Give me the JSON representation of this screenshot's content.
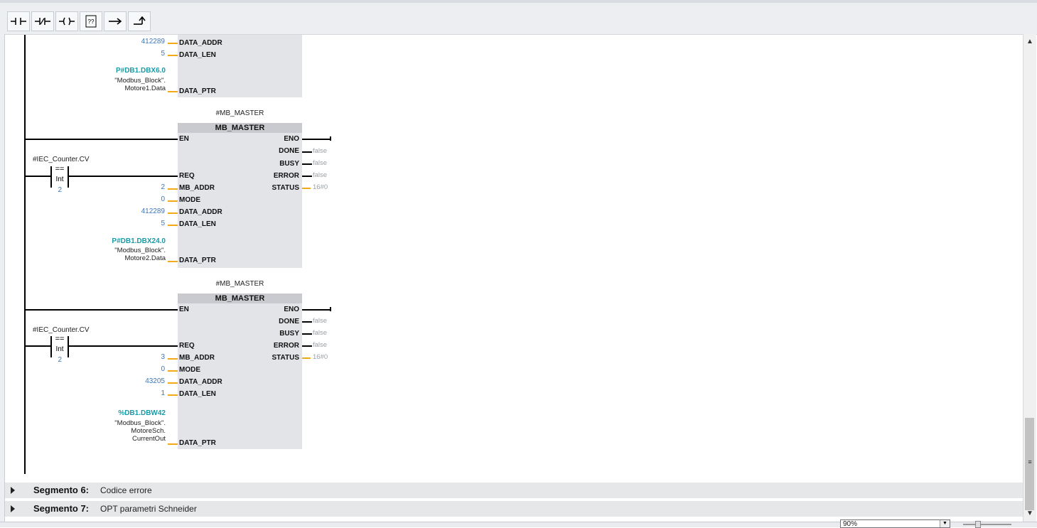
{
  "toolbar": {
    "buttons": [
      {
        "name": "normally-open-contact",
        "glyph": "no"
      },
      {
        "name": "normally-closed-contact",
        "glyph": "nc"
      },
      {
        "name": "output-coil",
        "glyph": "coil"
      },
      {
        "name": "empty-box",
        "glyph": "box",
        "label": "??"
      },
      {
        "name": "open-branch",
        "glyph": "branch"
      },
      {
        "name": "close-branch",
        "glyph": "close"
      }
    ]
  },
  "network_partial": {
    "data_addr_value": "412289",
    "data_len_value": "5",
    "ptr_address": "P#DB1.DBX6.0",
    "ptr_line1": "\"Modbus_Block\".",
    "ptr_line2": "Motore1.Data",
    "pins": {
      "data_addr": "DATA_ADDR",
      "data_len": "DATA_LEN",
      "data_ptr": "DATA_PTR"
    }
  },
  "blocks": [
    {
      "instance": "#MB_MASTER",
      "type": "MB_MASTER",
      "compare_operand": "#IEC_Counter.CV",
      "compare_op": "==",
      "compare_type": "Int",
      "compare_value": "2",
      "inputs": {
        "en": "EN",
        "req": "REQ",
        "mb_addr": "MB_ADDR",
        "mode": "MODE",
        "data_addr": "DATA_ADDR",
        "data_len": "DATA_LEN",
        "data_ptr": "DATA_PTR"
      },
      "outputs": {
        "eno": "ENO",
        "done": "DONE",
        "busy": "BUSY",
        "error": "ERROR",
        "status": "STATUS"
      },
      "values": {
        "mb_addr": "2",
        "mode": "0",
        "data_addr": "412289",
        "data_len": "5"
      },
      "output_values": {
        "done": "false",
        "busy": "false",
        "error": "false",
        "status": "16#0"
      },
      "ptr_address": "P#DB1.DBX24.0",
      "ptr_lines": [
        "\"Modbus_Block\".",
        "Motore2.Data"
      ]
    },
    {
      "instance": "#MB_MASTER",
      "type": "MB_MASTER",
      "compare_operand": "#IEC_Counter.CV",
      "compare_op": "==",
      "compare_type": "Int",
      "compare_value": "2",
      "inputs": {
        "en": "EN",
        "req": "REQ",
        "mb_addr": "MB_ADDR",
        "mode": "MODE",
        "data_addr": "DATA_ADDR",
        "data_len": "DATA_LEN",
        "data_ptr": "DATA_PTR"
      },
      "outputs": {
        "eno": "ENO",
        "done": "DONE",
        "busy": "BUSY",
        "error": "ERROR",
        "status": "STATUS"
      },
      "values": {
        "mb_addr": "3",
        "mode": "0",
        "data_addr": "43205",
        "data_len": "1"
      },
      "output_values": {
        "done": "false",
        "busy": "false",
        "error": "false",
        "status": "16#0"
      },
      "ptr_address": "%DB1.DBW42",
      "ptr_lines": [
        "\"Modbus_Block\".",
        "MotoreSch.",
        "CurrentOut"
      ]
    }
  ],
  "segments": [
    {
      "title": "Segmento 6:",
      "desc": "Codice errore"
    },
    {
      "title": "Segmento 7:",
      "desc": "OPT parametri Schneider"
    }
  ],
  "zoom": {
    "value": "90%"
  },
  "colors": {
    "pin_line": "#f4a91a",
    "value": "#3d77b8",
    "pointer": "#1b9aa6",
    "block": "#e3e4e8",
    "block_header": "#c9cad0"
  }
}
